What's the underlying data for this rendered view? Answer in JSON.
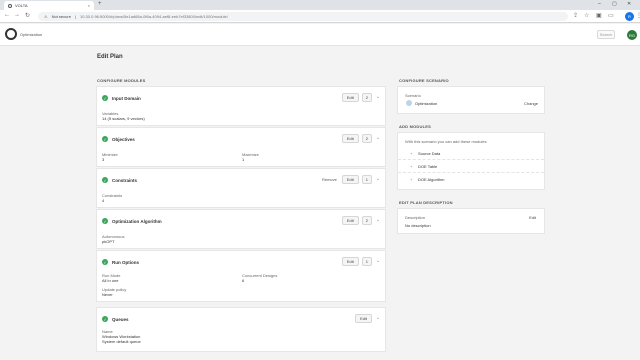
{
  "browser": {
    "tab_title": "VOLTA",
    "tab_close": "×",
    "new_tab": "+",
    "not_secure": "Not secure",
    "url": "10.30.0.96:5000/#/plans/5e1ad68a-0f6a-4094-aef8-eeb7ef33800/edit/1000/module/",
    "user_initial": "R"
  },
  "app": {
    "title": "Optimization",
    "search_label": "Search",
    "user_initials": "RG"
  },
  "page": {
    "title": "Edit Plan"
  },
  "configure_modules": {
    "heading": "CONFIGURE MODULES",
    "edit_label": "Edit",
    "remove_label": "Remove",
    "caret": "^",
    "modules": [
      {
        "name": "Input Domain",
        "count": "2",
        "fields": [
          {
            "label": "Variables",
            "value": "14 (5 scalars, 9 vectors)"
          }
        ]
      },
      {
        "name": "Objectives",
        "count": "2",
        "fields": [
          {
            "label": "Minimize",
            "value": "3"
          },
          {
            "label": "Maximize",
            "value": "1"
          }
        ]
      },
      {
        "name": "Constraints",
        "count": "1",
        "fields": [
          {
            "label": "Constraints",
            "value": "4"
          }
        ]
      },
      {
        "name": "Optimization Algorithm",
        "count": "2",
        "fields": [
          {
            "label": "Autonomous",
            "value": "pkOPT"
          }
        ]
      },
      {
        "name": "Run Options",
        "count": "1",
        "fields": [
          {
            "label": "Run Mode",
            "value": "All in one"
          },
          {
            "label": "Concurrent Designs",
            "value": "6"
          },
          {
            "label": "Update policy",
            "value": "Never"
          }
        ]
      },
      {
        "name": "Queues",
        "count": "",
        "fields": [
          {
            "label": "Name",
            "value": "Windows Workstation"
          },
          {
            "label": "",
            "value": "System default queue"
          }
        ]
      }
    ]
  },
  "configure_scenario": {
    "heading": "CONFIGURE SCENARIO",
    "label": "Scenario",
    "value": "Optimization",
    "change_label": "Change"
  },
  "add_modules": {
    "heading": "ADD MODULES",
    "intro": "With this scenario you can add these modules",
    "items": [
      "Source Data",
      "DOE Table",
      "DOE Algorithm"
    ]
  },
  "plan_description": {
    "heading": "EDIT PLAN DESCRIPTION",
    "label": "Description",
    "edit_label": "Edit",
    "value": "No description"
  }
}
